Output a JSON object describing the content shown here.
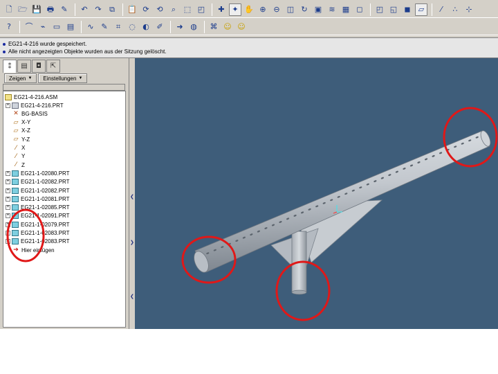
{
  "toolbar_top": {
    "icons": [
      "new-file-icon",
      "open-folder-icon",
      "save-icon",
      "print-icon",
      "brush-icon",
      "undo-icon",
      "redo-icon",
      "copy-icon",
      "paste-icon",
      "regenerate-icon",
      "regenerate-manager-icon",
      "find-icon",
      "select-box-icon",
      "repaint-icon",
      "spin-center-icon",
      "orient-mode-icon",
      "pan-icon",
      "zoom-in-icon",
      "zoom-out-icon",
      "refit-icon",
      "reorient-icon",
      "saved-views-icon",
      "layers-icon",
      "view-manager-icon",
      "wireframe-icon",
      "hidden-line-icon",
      "no-hidden-icon",
      "shading-icon",
      "datum-planes-icon",
      "datum-axes-icon",
      "datum-points-icon",
      "csys-icon"
    ]
  },
  "toolbar_second": {
    "icons": [
      "whats-this-icon",
      "sketch-tool-icon",
      "edge-tool-icon",
      "display-tool-icon",
      "table-icon",
      "curve-icon",
      "note-icon",
      "sketcher-icon",
      "spline-icon",
      "modify-icon",
      "pencil-icon",
      "arrow-red-icon",
      "analysis-icon",
      "parameters-icon",
      "smiley-icon",
      "smiley-icon-2"
    ]
  },
  "messages": [
    "EG21-4-216 wurde gespeichert.",
    "Alle nicht angezeigten Objekte wurden aus der Sitzung gelöscht."
  ],
  "panel": {
    "tabs": [
      "model-tree-tab-icon",
      "folder-browser-tab-icon",
      "favorites-tab-icon",
      "connection-tab-icon"
    ],
    "show_button": "Zeigen",
    "settings_button": "Einstellungen"
  },
  "tree": {
    "root": "EG21-4-216.ASM",
    "items": [
      {
        "label": "EG21-4-216.PRT",
        "kind": "part-main",
        "expandable": true
      },
      {
        "label": "BG-BASIS",
        "kind": "csys",
        "expandable": false
      },
      {
        "label": "X-Y",
        "kind": "plane",
        "expandable": false
      },
      {
        "label": "X-Z",
        "kind": "plane",
        "expandable": false
      },
      {
        "label": "Y-Z",
        "kind": "plane",
        "expandable": false
      },
      {
        "label": "X",
        "kind": "axis",
        "expandable": false
      },
      {
        "label": "Y",
        "kind": "axis",
        "expandable": false
      },
      {
        "label": "Z",
        "kind": "axis",
        "expandable": false
      },
      {
        "label": "EG21-1-02080.PRT",
        "kind": "part",
        "expandable": true
      },
      {
        "label": "EG21-1-02082.PRT",
        "kind": "part",
        "expandable": true
      },
      {
        "label": "EG21-1-02082.PRT",
        "kind": "part",
        "expandable": true
      },
      {
        "label": "EG21-1-02081.PRT",
        "kind": "part",
        "expandable": true
      },
      {
        "label": "EG21-1-02085.PRT",
        "kind": "part",
        "expandable": true
      },
      {
        "label": "EG21-1-02091.PRT",
        "kind": "part",
        "expandable": true
      },
      {
        "label": "EG21-1-02079.PRT",
        "kind": "part",
        "expandable": true
      },
      {
        "label": "EG21-1-02083.PRT",
        "kind": "part",
        "expandable": true
      },
      {
        "label": "EG21-1-02083.PRT",
        "kind": "part",
        "expandable": true
      },
      {
        "label": "Hier einfügen",
        "kind": "insert",
        "expandable": false
      }
    ]
  },
  "colors": {
    "viewport_bg": "#3e5d7a",
    "highlight_circle": "#e01818",
    "model_fill": "#bcc2c8"
  }
}
